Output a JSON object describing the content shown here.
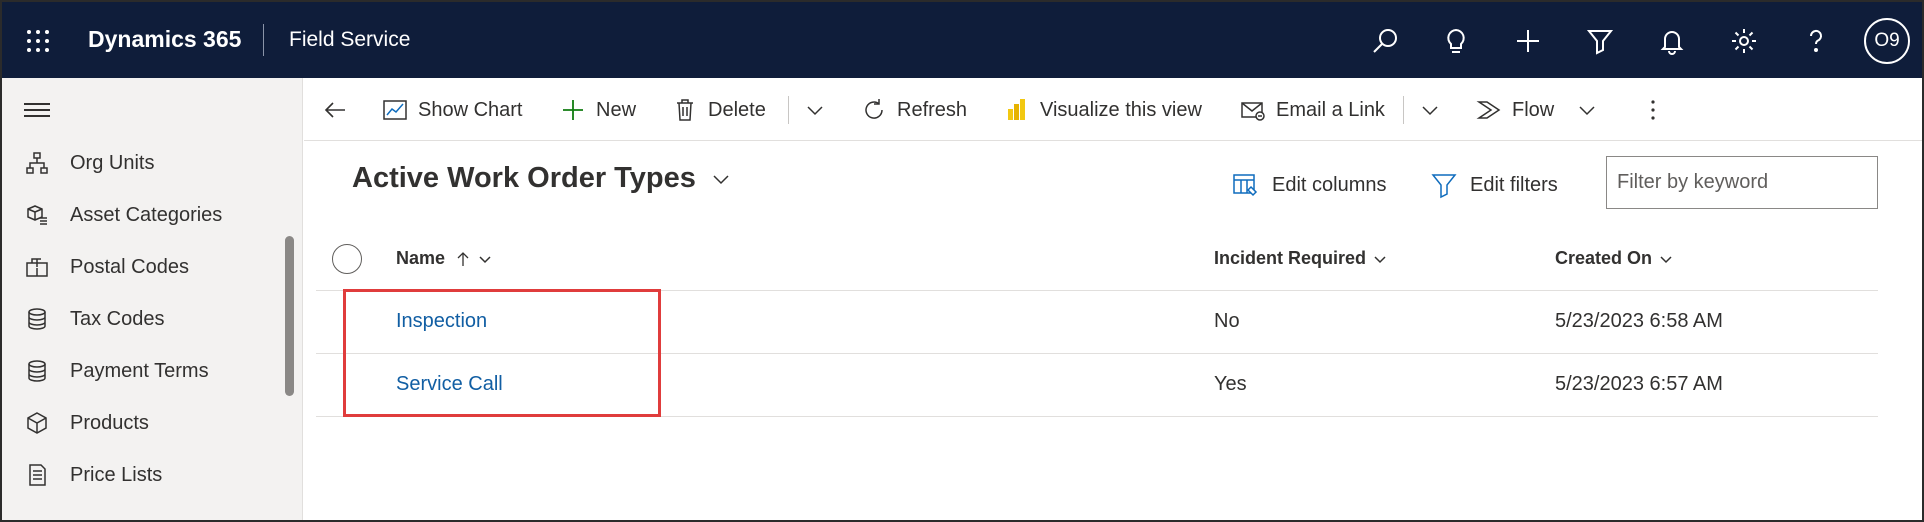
{
  "app": {
    "name": "Dynamics 365",
    "module": "Field Service",
    "user_initials": "O9"
  },
  "top_icons": [
    "search-icon",
    "lightbulb-icon",
    "plus-icon",
    "filter-icon",
    "bell-icon",
    "gear-icon",
    "help-icon"
  ],
  "sidebar": {
    "items": [
      {
        "label": "Org Units",
        "icon": "org-units-icon"
      },
      {
        "label": "Asset Categories",
        "icon": "asset-categories-icon"
      },
      {
        "label": "Postal Codes",
        "icon": "postal-codes-icon"
      },
      {
        "label": "Tax Codes",
        "icon": "tax-codes-icon"
      },
      {
        "label": "Payment Terms",
        "icon": "payment-terms-icon"
      },
      {
        "label": "Products",
        "icon": "products-icon"
      },
      {
        "label": "Price Lists",
        "icon": "price-lists-icon"
      }
    ]
  },
  "commandbar": {
    "show_chart": "Show Chart",
    "new": "New",
    "delete": "Delete",
    "refresh": "Refresh",
    "visualize": "Visualize this view",
    "email_link": "Email a Link",
    "flow": "Flow"
  },
  "view": {
    "title": "Active Work Order Types",
    "edit_columns": "Edit columns",
    "edit_filters": "Edit filters",
    "filter_placeholder": "Filter by keyword"
  },
  "grid": {
    "columns": [
      "Name",
      "Incident Required",
      "Created On"
    ],
    "rows": [
      {
        "name": "Inspection",
        "incident_required": "No",
        "created_on": "5/23/2023 6:58 AM"
      },
      {
        "name": "Service Call",
        "incident_required": "Yes",
        "created_on": "5/23/2023 6:57 AM"
      }
    ]
  },
  "colors": {
    "topbar": "#0f1d3a",
    "link": "#115ea3",
    "highlight": "#e03c3c",
    "new_plus": "#107c10",
    "powerbi": "#f2c811"
  }
}
